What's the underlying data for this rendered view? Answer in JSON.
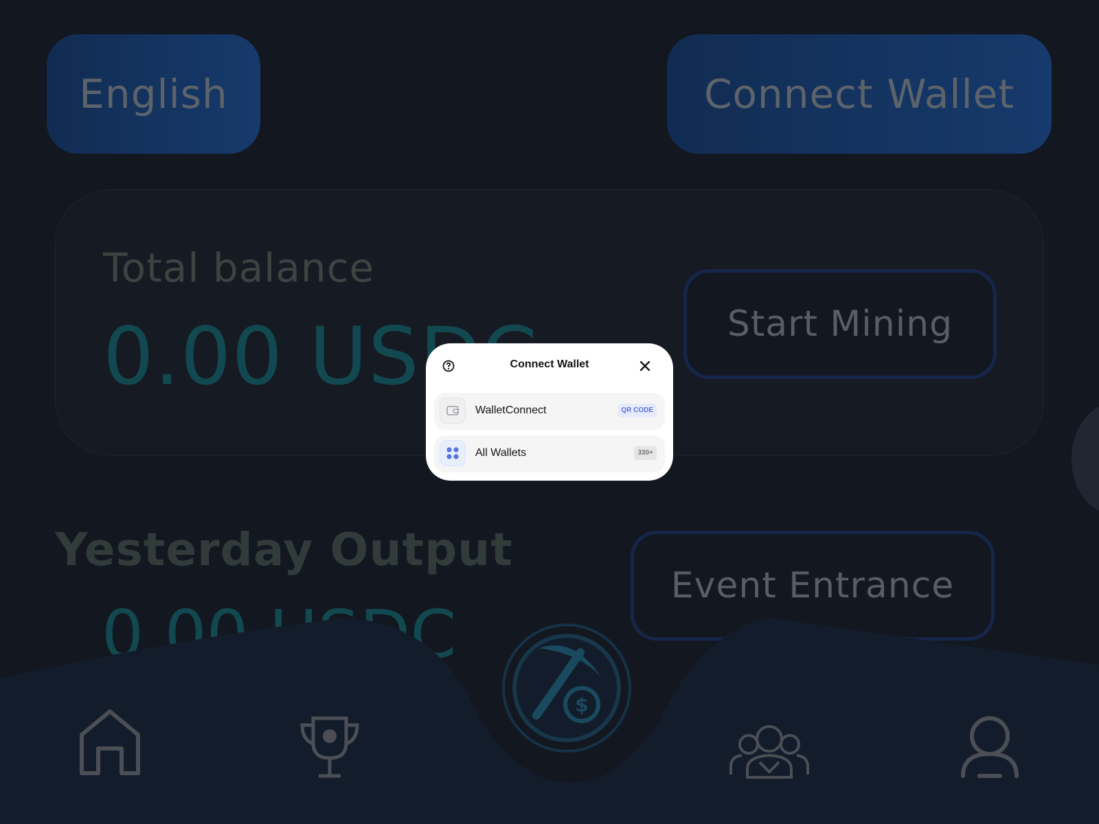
{
  "header": {
    "language_label": "English",
    "connect_wallet_label": "Connect Wallet"
  },
  "balance": {
    "label": "Total balance",
    "value": "0.00 USDC",
    "start_mining_label": "Start Mining"
  },
  "output": {
    "label": "Yesterday Output",
    "value": "0.00 USDC",
    "event_label": "Event Entrance"
  },
  "nav": {
    "items": [
      {
        "icon": "home-icon"
      },
      {
        "icon": "trophy-icon"
      },
      {
        "icon": "mining-icon"
      },
      {
        "icon": "team-icon"
      },
      {
        "icon": "profile-icon"
      }
    ]
  },
  "modal": {
    "title": "Connect Wallet",
    "options": [
      {
        "label": "WalletConnect",
        "tag": "QR CODE",
        "icon": "wallet-icon"
      },
      {
        "label": "All Wallets",
        "tag": "330+",
        "icon": "grid-icon"
      }
    ]
  },
  "colors": {
    "background": "#131720",
    "accent_blue": "#163a6c",
    "value_teal": "#12484f",
    "modal_bg": "#ffffff"
  }
}
